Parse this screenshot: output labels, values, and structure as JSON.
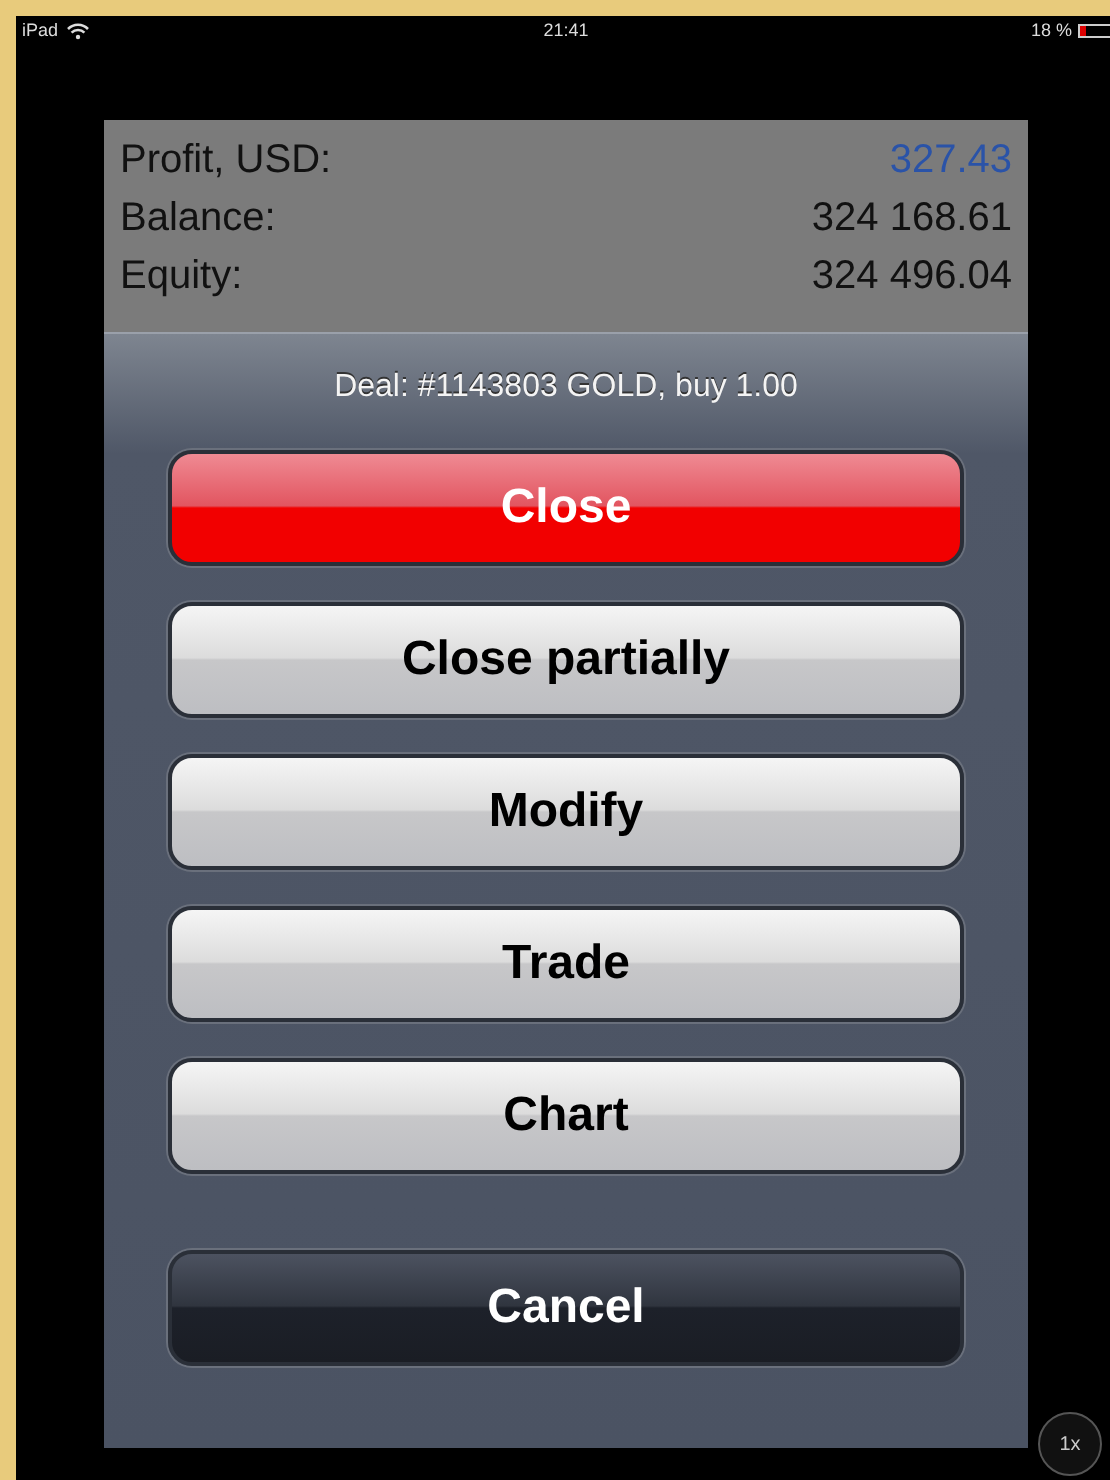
{
  "status_bar": {
    "device": "iPad",
    "time": "21:41",
    "battery": "18 %"
  },
  "account": [
    {
      "label": "Profit, USD:",
      "value": "327.43",
      "kind": "highlight"
    },
    {
      "label": "Balance:",
      "value": "324 168.61",
      "kind": "plain"
    },
    {
      "label": "Equity:",
      "value": "324 496.04",
      "kind": "plain"
    }
  ],
  "action_sheet": {
    "title": "Deal: #1143803 GOLD, buy 1.00",
    "buttons": [
      {
        "label": "Close",
        "kind": "destructive"
      },
      {
        "label": "Close partially",
        "kind": "default"
      },
      {
        "label": "Modify",
        "kind": "default"
      },
      {
        "label": "Trade",
        "kind": "default"
      },
      {
        "label": "Chart",
        "kind": "default"
      },
      {
        "label": "Cancel",
        "kind": "cancel"
      }
    ]
  },
  "zoom_badge": "1x"
}
